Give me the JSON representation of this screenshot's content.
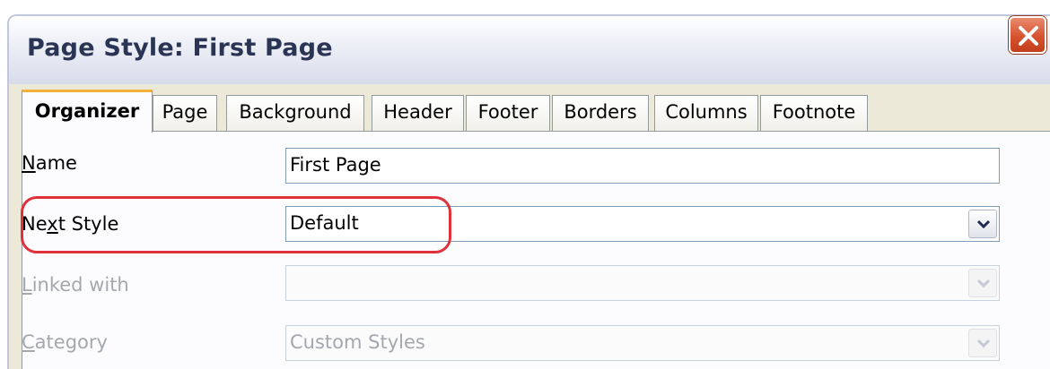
{
  "window": {
    "title": "Page Style: First Page"
  },
  "tabs": [
    {
      "label": "Organizer",
      "active": true
    },
    {
      "label": "Page",
      "active": false
    },
    {
      "label": "Background",
      "active": false
    },
    {
      "label": "Header",
      "active": false
    },
    {
      "label": "Footer",
      "active": false
    },
    {
      "label": "Borders",
      "active": false
    },
    {
      "label": "Columns",
      "active": false
    },
    {
      "label": "Footnote",
      "active": false
    }
  ],
  "form": {
    "name": {
      "label_pre": "",
      "label_key": "N",
      "label_post": "ame",
      "value": "First Page"
    },
    "next_style": {
      "label_pre": "Ne",
      "label_key": "x",
      "label_post": "t Style",
      "value": "Default"
    },
    "linked_with": {
      "label_pre": "",
      "label_key": "L",
      "label_post": "inked with",
      "value": ""
    },
    "category": {
      "label_pre": "",
      "label_key": "C",
      "label_post": "ategory",
      "value": "Custom Styles"
    }
  },
  "icons": {
    "close": "close-icon",
    "dropdown": "chevron-down-icon"
  },
  "colors": {
    "highlight": "#e0303a",
    "close_button": "#d6532e",
    "active_tab_accent": "#f4b13a"
  }
}
